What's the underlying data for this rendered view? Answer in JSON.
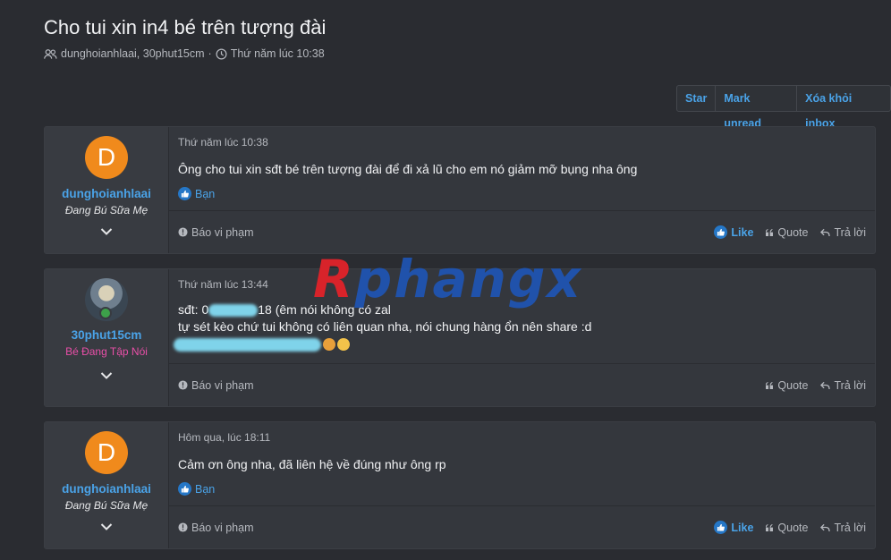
{
  "thread": {
    "title": "Cho tui xin in4 bé trên tượng đài",
    "participants": "dunghoianhlaai, 30phut15cm",
    "separator": "·",
    "date": "Thứ năm lúc 10:38"
  },
  "toolbar": {
    "star": "Star",
    "mark_unread": "Mark unread",
    "leave": "Xóa khỏi inbox"
  },
  "messages": [
    {
      "avatar_letter": "D",
      "username": "dunghoianhlaai",
      "user_title": "Đang Bú Sữa Mẹ",
      "date": "Thứ năm lúc 10:38",
      "text": "Ông cho tui xin sđt bé trên tượng đài để đi xả lũ cho em nó giảm mỡ bụng nha ông",
      "reaction": "Bạn",
      "report": "Báo vi phạm",
      "like": "Like",
      "quote": "Quote",
      "reply": "Trả lời"
    },
    {
      "username": "30phut15cm",
      "user_title": "Bé Đang Tập Nói",
      "date": "Thứ năm lúc 13:44",
      "line1_prefix": "sđt: 0",
      "line1_suffix": "18 (êm nói không có zal",
      "line2": "tự sét kèo chứ tui không có liên quan nha, nói chung hàng ổn nên share :d",
      "report": "Báo vi phạm",
      "quote": "Quote",
      "reply": "Trả lời"
    },
    {
      "avatar_letter": "D",
      "username": "dunghoianhlaai",
      "user_title": "Đang Bú Sữa Mẹ",
      "date": "Hôm qua, lúc 18:11",
      "text": "Cảm ơn ông nha, đã liên hệ về đúng như ông rp",
      "reaction": "Bạn",
      "report": "Báo vi phạm",
      "like": "Like",
      "quote": "Quote",
      "reply": "Trả lời"
    }
  ],
  "watermark": {
    "first": "R",
    "rest": "phangx"
  },
  "colors": {
    "accent": "#4aa3e8",
    "avatar_orange": "#f08a1c",
    "title_pink": "#e94fa8"
  }
}
